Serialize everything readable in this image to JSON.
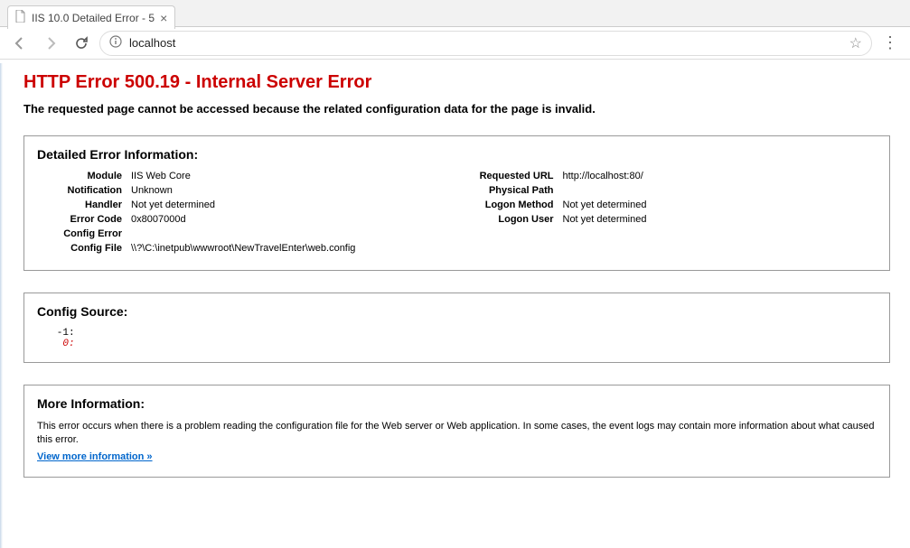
{
  "window": {
    "tab_title": "IIS 10.0 Detailed Error - 5"
  },
  "address_bar": {
    "url": "localhost"
  },
  "error": {
    "title": "HTTP Error 500.19 - Internal Server Error",
    "subtitle": "The requested page cannot be accessed because the related configuration data for the page is invalid."
  },
  "detailed": {
    "heading": "Detailed Error Information:",
    "labels": {
      "module": "Module",
      "notification": "Notification",
      "handler": "Handler",
      "error_code": "Error Code",
      "config_error": "Config Error",
      "config_file": "Config File",
      "requested_url": "Requested URL",
      "physical_path": "Physical Path",
      "logon_method": "Logon Method",
      "logon_user": "Logon User"
    },
    "values": {
      "module": "IIS Web Core",
      "notification": "Unknown",
      "handler": "Not yet determined",
      "error_code": "0x8007000d",
      "config_error": "",
      "config_file": "\\\\?\\C:\\inetpub\\wwwroot\\NewTravelEnter\\web.config",
      "requested_url": "http://localhost:80/",
      "physical_path": "",
      "logon_method": "Not yet determined",
      "logon_user": "Not yet determined"
    }
  },
  "config_source": {
    "heading": "Config Source:",
    "line1": "   -1: ",
    "line2": "    0: "
  },
  "more_info": {
    "heading": "More Information:",
    "text": "This error occurs when there is a problem reading the configuration file for the Web server or Web application. In some cases, the event logs may contain more information about what caused this error.",
    "link_text": "View more information »"
  }
}
